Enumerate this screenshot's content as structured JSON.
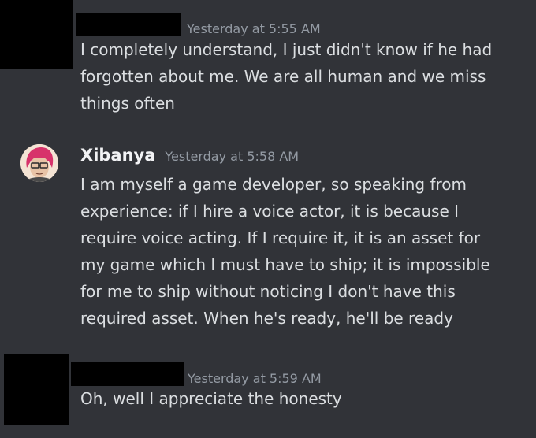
{
  "messages": [
    {
      "author_redacted": true,
      "timestamp": "Yesterday at 5:55 AM",
      "lines": [
        "I completely understand, I just didn't know if he had",
        "forgotten about me. We are all human and we miss",
        "things often"
      ]
    },
    {
      "author": "Xibanya",
      "avatar_icon": "xibanya-avatar-icon",
      "timestamp": "Yesterday at 5:58 AM",
      "lines": [
        "I am myself a game developer, so speaking from",
        "experience: if I hire a voice actor, it is because I",
        "require voice acting. If I require it, it is an asset for",
        "my game which I must have to ship; it is impossible",
        "for me to ship without noticing I don't have this",
        "required asset. When he's ready, he'll be ready"
      ]
    },
    {
      "author_redacted": true,
      "timestamp": "Yesterday at 5:59 AM",
      "lines": [
        "Oh, well I appreciate the honesty"
      ]
    }
  ],
  "colors": {
    "background": "#313338",
    "text": "#dbdee1",
    "username": "#f2f3f5",
    "timestamp": "#949ba4",
    "redaction": "#000000",
    "avatar_hair": "#d7336b"
  }
}
